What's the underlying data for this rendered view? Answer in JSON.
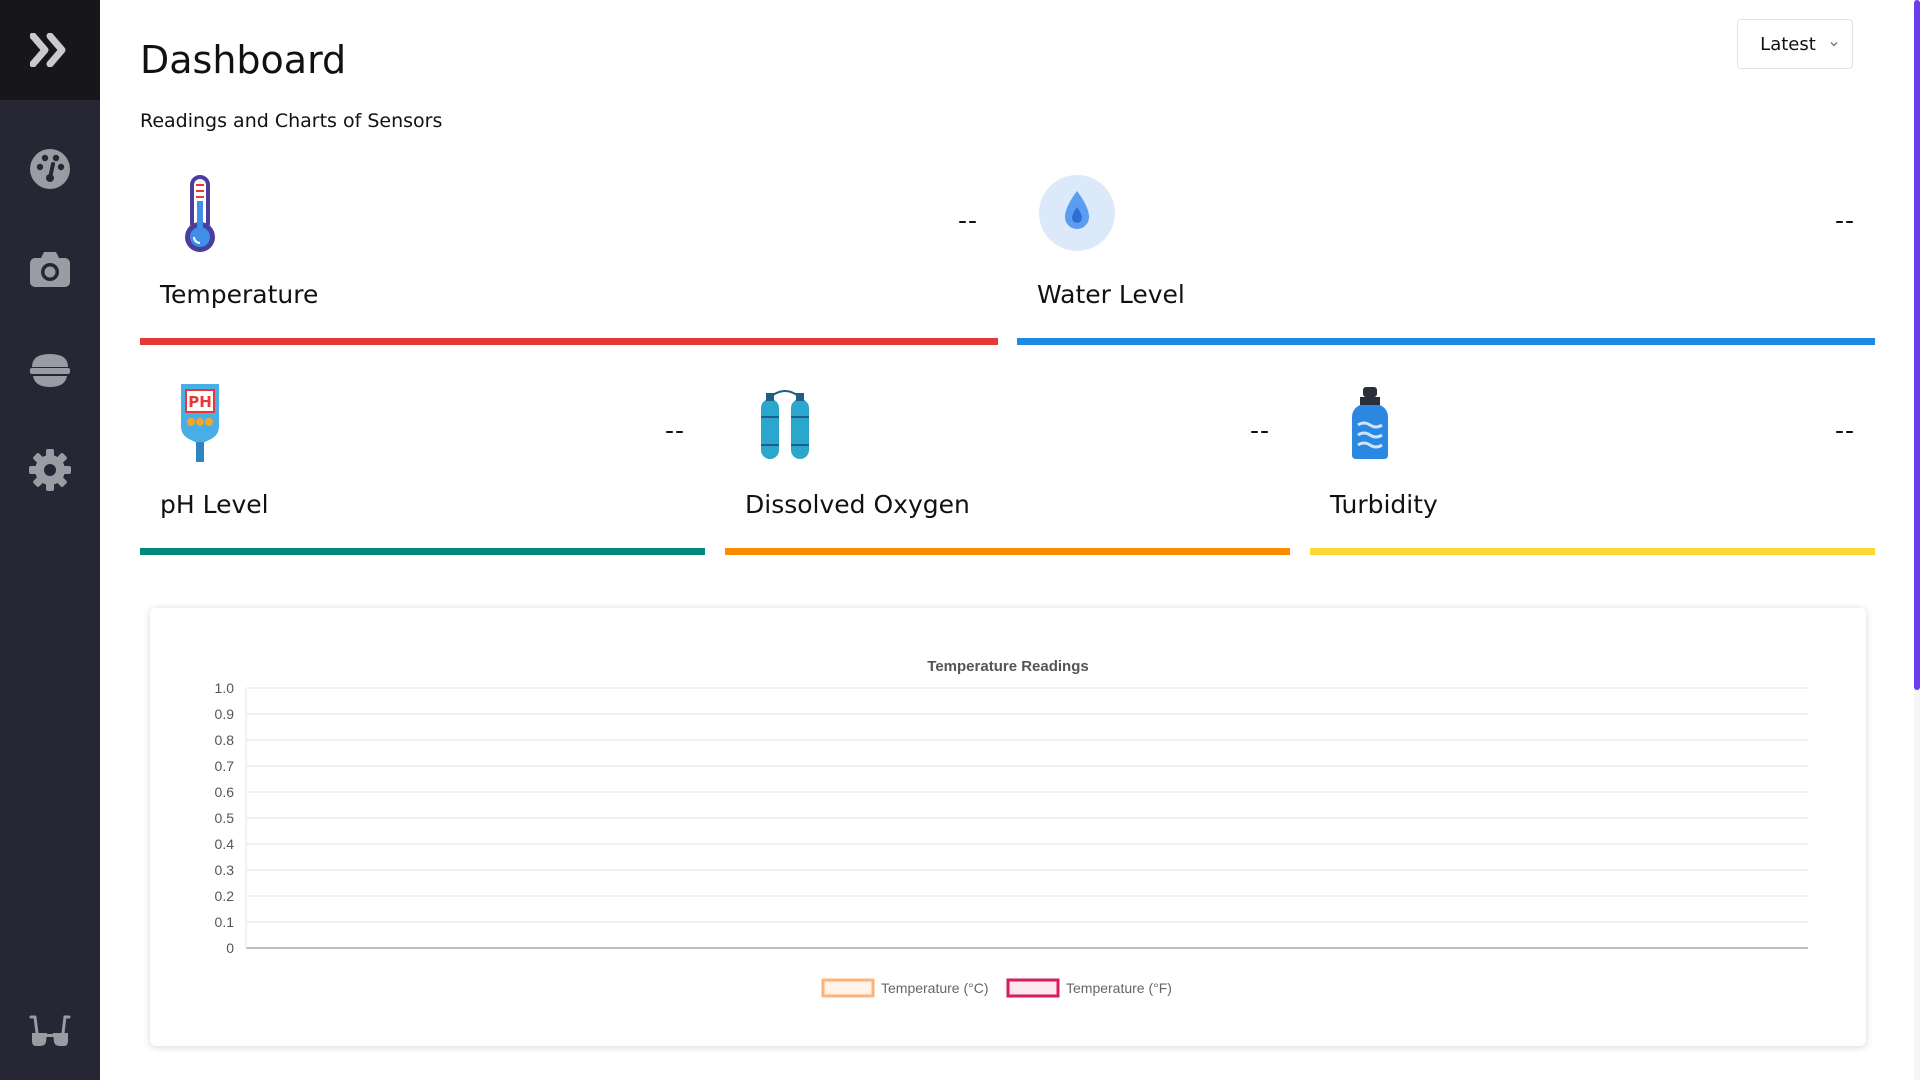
{
  "sidebar": {
    "items": [
      {
        "name": "dashboard",
        "icon": "palette-gauge-icon"
      },
      {
        "name": "camera",
        "icon": "camera-icon"
      },
      {
        "name": "feeder",
        "icon": "bowl-icon"
      },
      {
        "name": "settings",
        "icon": "gear-icon"
      },
      {
        "name": "about",
        "icon": "glasses-icon"
      }
    ],
    "toggle_icon": "double-chevron-right-icon"
  },
  "header": {
    "title": "Dashboard",
    "subtitle": "Readings and Charts of Sensors",
    "range_select": {
      "selected": "Latest"
    }
  },
  "cards": [
    {
      "key": "temperature",
      "label": "Temperature",
      "value": "--",
      "color": "#e53935",
      "icon": "thermometer-icon"
    },
    {
      "key": "water_level",
      "label": "Water Level",
      "value": "--",
      "color": "#1e88e5",
      "icon": "water-drop-icon"
    },
    {
      "key": "ph_level",
      "label": "pH Level",
      "value": "--",
      "color": "#00897b",
      "icon": "ph-meter-icon"
    },
    {
      "key": "dissolved_oxygen",
      "label": "Dissolved Oxygen",
      "value": "--",
      "color": "#fb8c00",
      "icon": "oxygen-tanks-icon"
    },
    {
      "key": "turbidity",
      "label": "Turbidity",
      "value": "--",
      "color": "#fdd835",
      "icon": "water-bottle-icon"
    }
  ],
  "chart_data": {
    "type": "line",
    "title": "Temperature Readings",
    "x": [],
    "ylim": [
      0,
      1.0
    ],
    "yticks": [
      "1.0",
      "0.9",
      "0.8",
      "0.7",
      "0.6",
      "0.5",
      "0.4",
      "0.3",
      "0.2",
      "0.1",
      "0"
    ],
    "grid": true,
    "legend_position": "bottom",
    "series": [
      {
        "name": "Temperature (°C)",
        "values": [],
        "stroke": "#ffb27a",
        "fill": "#fff3ea"
      },
      {
        "name": "Temperature (°F)",
        "values": [],
        "stroke": "#d81b60",
        "fill": "#fde7ef"
      }
    ]
  }
}
